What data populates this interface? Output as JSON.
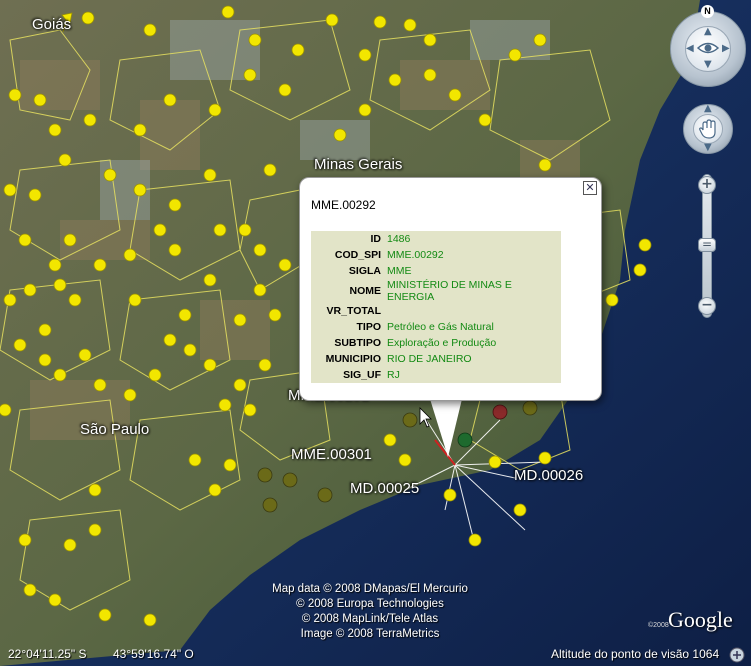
{
  "map": {
    "place_labels": [
      "Goiás",
      "Minas Gerais",
      "São Paulo"
    ],
    "pin_labels": [
      "MME.00301",
      "MD.00025",
      "MD.00026",
      "MME.00292"
    ]
  },
  "balloon": {
    "title": "MME.00292",
    "close_label": "✕",
    "rows": [
      {
        "key": "ID",
        "value": "1486"
      },
      {
        "key": "COD_SPI",
        "value": "MME.00292"
      },
      {
        "key": "SIGLA",
        "value": "MME"
      },
      {
        "key": "NOME",
        "value": "MINISTÉRIO DE MINAS E ENERGIA"
      },
      {
        "key": "VR_TOTAL",
        "value": ""
      },
      {
        "key": "TIPO",
        "value": "Petróleo e Gás Natural"
      },
      {
        "key": "SUBTIPO",
        "value": "Exploração e Produção"
      },
      {
        "key": "MUNICIPIO",
        "value": "RIO DE JANEIRO"
      },
      {
        "key": "SIG_UF",
        "value": "RJ"
      }
    ]
  },
  "credits": [
    "Map data © 2008 DMapas/El Mercurio",
    "© 2008 Europa Technologies",
    "© 2008 MapLink/Tele Atlas",
    "Image © 2008 TerraMetrics"
  ],
  "google_logo": "Google",
  "copyright_small": "©2008",
  "status": {
    "latitude": "22°04'11.25\" S",
    "longitude": "43°59'16.74\" O",
    "altitude": "Altitude do ponto de visão  1064"
  },
  "navigation": {
    "north_label": "N",
    "zoom_in": "+",
    "zoom_out": "−",
    "zoom_slider": "="
  },
  "colors": {
    "pin_yellow": "#f2e600",
    "pin_dark": "#6b6a18",
    "pin_red": "#8a2a2a",
    "pin_green": "#1e6a2e",
    "value_green": "#138a13",
    "table_bg": "#e2e4c8"
  }
}
